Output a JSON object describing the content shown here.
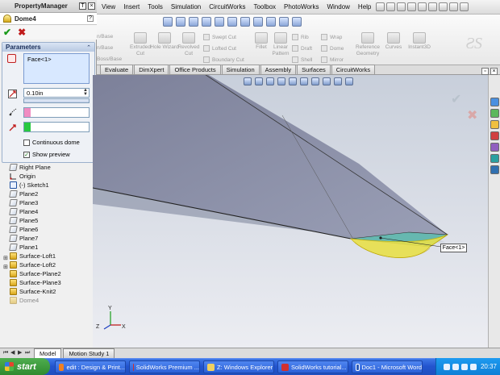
{
  "menubar": {
    "items": [
      "View",
      "Insert",
      "Tools",
      "Simulation",
      "CircuitWorks",
      "Toolbox",
      "PhotoWorks",
      "Window",
      "Help"
    ]
  },
  "command_manager": {
    "features_left": [
      "Extruded Cut",
      "Hole Wizard",
      "Revolved Cut"
    ],
    "features_row": [
      "Swept Cut",
      "Lofted Cut",
      "Boundary Cut"
    ],
    "features_mid": [
      "Fillet",
      "Linear Pattern"
    ],
    "features_small": [
      "Rib",
      "Draft",
      "Shell"
    ],
    "features_small2": [
      "Wrap",
      "Dome",
      "Mirror"
    ],
    "features_right": [
      "Reference Geometry",
      "Curves",
      "Instant3D"
    ],
    "left_cut": [
      "n/Base",
      "n/Base",
      "Boss/Base"
    ]
  },
  "feature_tabs": [
    "Evaluate",
    "DimXpert",
    "Office Products",
    "Simulation",
    "Assembly",
    "Surfaces",
    "CircuitWorks"
  ],
  "property_manager": {
    "title": "PropertyManager",
    "feature_name": "Dome4",
    "params_title": "Parameters",
    "face_entry": "Face<1>",
    "distance": "0.10in",
    "continuous_dome_label": "Continuous dome",
    "continuous_dome_checked": false,
    "show_preview_label": "Show preview",
    "show_preview_checked": true
  },
  "tree": {
    "items": [
      {
        "label": "Right Plane",
        "icon": "plane-icon"
      },
      {
        "label": "Origin",
        "icon": "origin-icon"
      },
      {
        "label": "(-) Sketch1",
        "icon": "sketch-icon"
      },
      {
        "label": "Plane2",
        "icon": "plane-icon"
      },
      {
        "label": "Plane3",
        "icon": "plane-icon"
      },
      {
        "label": "Plane4",
        "icon": "plane-icon"
      },
      {
        "label": "Plane5",
        "icon": "plane-icon"
      },
      {
        "label": "Plane6",
        "icon": "plane-icon"
      },
      {
        "label": "Plane7",
        "icon": "plane-icon"
      },
      {
        "label": "Plane1",
        "icon": "plane-icon"
      },
      {
        "label": "Surface-Loft1",
        "icon": "surface-icon"
      },
      {
        "label": "Surface-Loft2",
        "icon": "surface-icon"
      },
      {
        "label": "Surface-Plane2",
        "icon": "surface-icon"
      },
      {
        "label": "Surface-Plane3",
        "icon": "surface-icon"
      },
      {
        "label": "Surface-Knit2",
        "icon": "surface-icon"
      },
      {
        "label": "Dome4",
        "icon": "dome-icon"
      }
    ]
  },
  "graphics": {
    "callout_label": "Face<1>",
    "axis_labels": [
      "Y",
      "Z",
      "X"
    ]
  },
  "bottom_tabs": [
    "Model",
    "Motion Study 1"
  ],
  "taskbar": {
    "start_label": "start",
    "tasks": [
      "edit : Design & Print...",
      "SolidWorks Premium ...",
      "Z: Windows Explorer",
      "SolidWorks tutorial...",
      "Doc1 - Microsoft Word"
    ],
    "clock": "20:37"
  },
  "colors": {
    "accent": "#2355cf",
    "ok": "#1a9a1a",
    "cancel": "#c01a1a",
    "model_gray": "#8a8fa6",
    "dome_yellow": "#e8e04a",
    "face_teal": "#66b8b0"
  }
}
